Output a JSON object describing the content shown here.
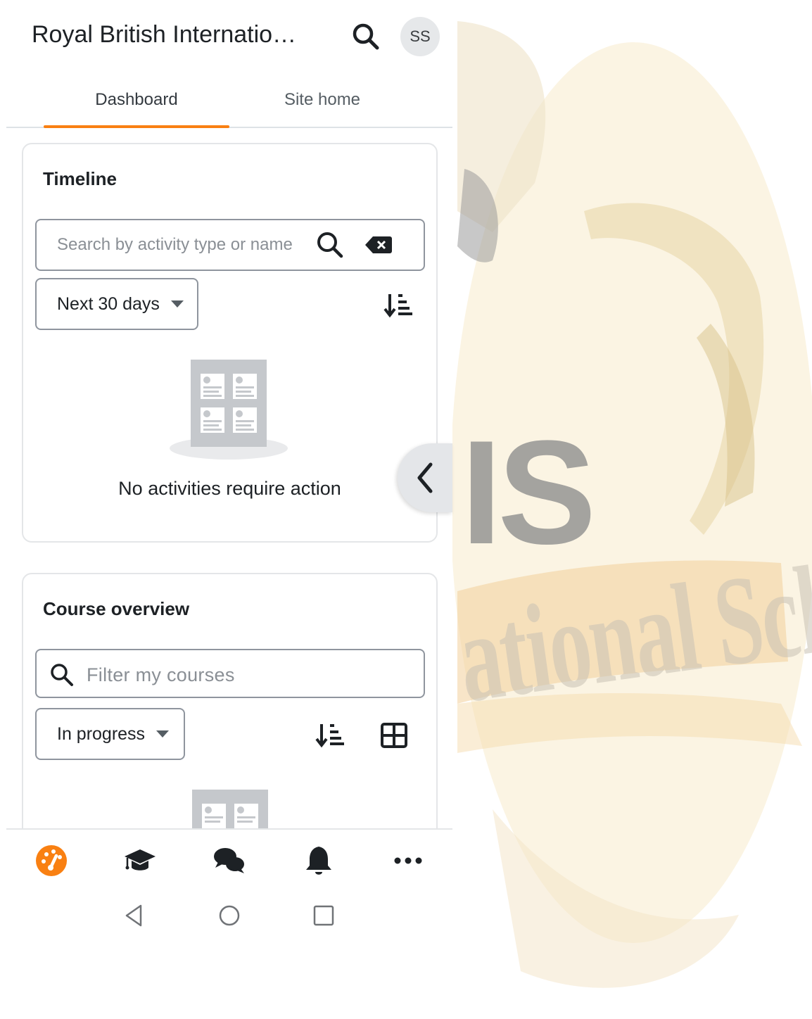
{
  "header": {
    "title": "Royal British Internatio…",
    "avatar_initials": "SS"
  },
  "tabs": [
    {
      "label": "Dashboard",
      "active": true
    },
    {
      "label": "Site home",
      "active": false
    }
  ],
  "timeline": {
    "title": "Timeline",
    "search_placeholder": "Search by activity type or name",
    "filter_selected": "Next 30 days",
    "empty_message": "No activities require action"
  },
  "course_overview": {
    "title": "Course overview",
    "filter_placeholder": "Filter my courses",
    "filter_selected": "In progress"
  },
  "bottom_nav": [
    {
      "icon": "dashboard-icon",
      "active": true
    },
    {
      "icon": "graduation-cap-icon",
      "active": false
    },
    {
      "icon": "messages-icon",
      "active": false
    },
    {
      "icon": "bell-icon",
      "active": false
    },
    {
      "icon": "more-icon",
      "active": false
    }
  ],
  "watermark": {
    "letters": "IS",
    "text": "ational School"
  },
  "colors": {
    "accent": "#f98012",
    "text": "#1d2125",
    "border": "#8f959e"
  }
}
